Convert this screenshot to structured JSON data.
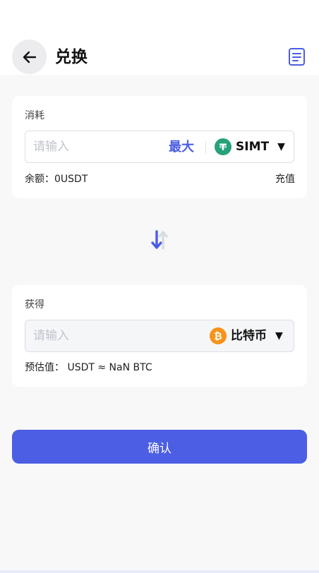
{
  "header": {
    "title": "兑换"
  },
  "consume": {
    "label": "消耗",
    "placeholder": "请输入",
    "max_label": "最大",
    "coin_name": "SIMT",
    "coin_icon": "tether-icon",
    "balance": "余额：0USDT",
    "recharge_label": "充值"
  },
  "receive": {
    "label": "获得",
    "placeholder": "请输入",
    "coin_name": "比特币",
    "coin_icon": "bitcoin-icon",
    "estimate": "预估值： USDT ≈ NaN BTC"
  },
  "actions": {
    "confirm_label": "确认"
  },
  "colors": {
    "accent": "#4b5ee4",
    "tether": "#26a17b",
    "bitcoin": "#f7931a"
  }
}
